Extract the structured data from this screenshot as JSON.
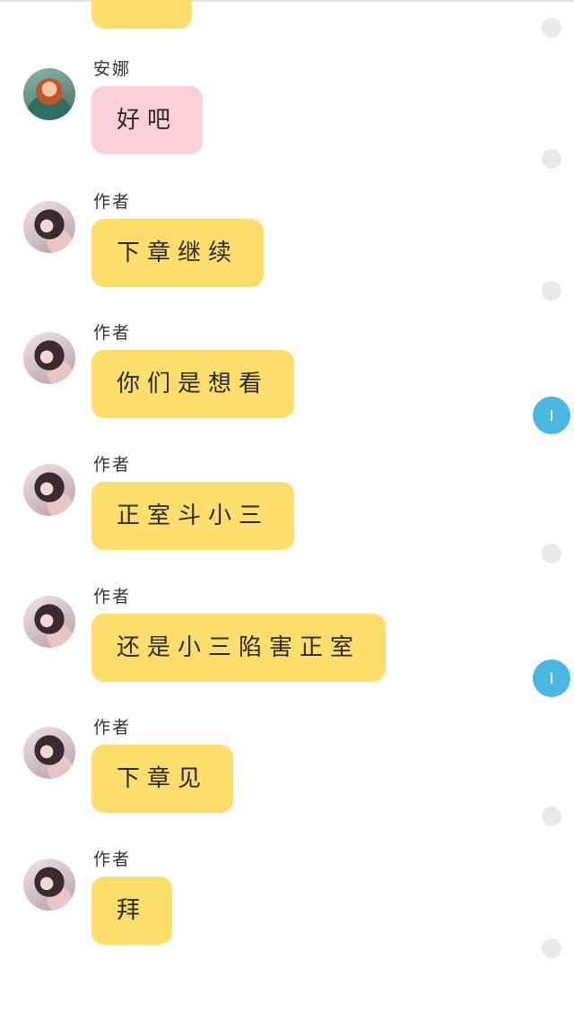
{
  "messages": [
    {
      "sender": "安娜",
      "text": "好吧",
      "avatar": "anna-avatar",
      "bubble_color": "#fcd0d9"
    },
    {
      "sender": "作者",
      "text": "下章继续",
      "avatar": "author-avatar",
      "bubble_color": "#fddd6b"
    },
    {
      "sender": "作者",
      "text": "你们是想看",
      "avatar": "author-avatar",
      "bubble_color": "#fddd6b"
    },
    {
      "sender": "作者",
      "text": "正室斗小三",
      "avatar": "author-avatar",
      "bubble_color": "#fddd6b"
    },
    {
      "sender": "作者",
      "text": "还是小三陷害正室",
      "avatar": "author-avatar",
      "bubble_color": "#fddd6b"
    },
    {
      "sender": "作者",
      "text": "下章见",
      "avatar": "author-avatar",
      "bubble_color": "#fddd6b"
    },
    {
      "sender": "作者",
      "text": "拜",
      "avatar": "author-avatar",
      "bubble_color": "#fddd6b"
    }
  ],
  "colors": {
    "author_bubble": "#fddd6b",
    "anna_bubble": "#fcd0d9",
    "unread_indicator": "#4ab7e3",
    "read_indicator": "#eaeaea"
  }
}
